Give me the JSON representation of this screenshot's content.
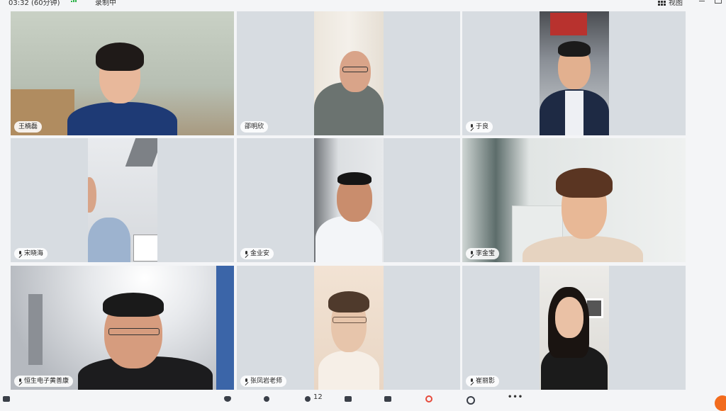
{
  "header": {
    "timer": "03:32 (60分钟)",
    "recording": "录制中",
    "view_label": "视图"
  },
  "participants": [
    {
      "name": "王楠磊",
      "mic_icon": false
    },
    {
      "name": "邵明欣",
      "mic_icon": false
    },
    {
      "name": "于良",
      "mic_icon": true
    },
    {
      "name": "宋晓海",
      "mic_icon": true
    },
    {
      "name": "金业安",
      "mic_icon": true
    },
    {
      "name": "李金宝",
      "mic_icon": true
    },
    {
      "name": "恒生电子黄善康",
      "mic_icon": true
    },
    {
      "name": "张凤岩老师",
      "mic_icon": true
    },
    {
      "name": "崔丽影",
      "mic_icon": true
    }
  ],
  "toolbar": {
    "participants_count": "12"
  },
  "colors": {
    "tile_background": "#d7dce1",
    "page_background": "#f4f5f7",
    "recording_red": "#e64a3b",
    "accent_orange": "#f26b1d"
  }
}
